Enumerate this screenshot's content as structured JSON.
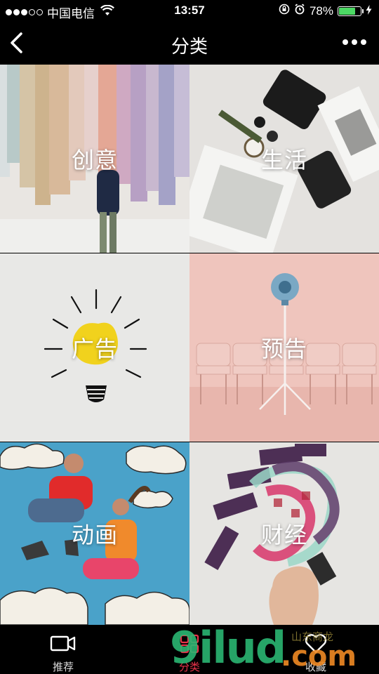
{
  "status_bar": {
    "carrier": "中国电信",
    "time": "13:57",
    "battery_percent": "78%",
    "battery_level": 0.78,
    "battery_color": "#4cd964"
  },
  "nav": {
    "title": "分类",
    "back_icon": "chevron-left-icon",
    "more_icon": "more-dots-icon"
  },
  "categories": [
    {
      "label": "创意",
      "icon": "paper-strips-photo"
    },
    {
      "label": "生活",
      "icon": "desk-flatlay-photo"
    },
    {
      "label": "广告",
      "icon": "lightbulb-photo"
    },
    {
      "label": "预告",
      "icon": "megaphone-photo"
    },
    {
      "label": "动画",
      "icon": "couple-clouds-photo"
    },
    {
      "label": "财经",
      "icon": "cards-photo"
    }
  ],
  "tabbar": {
    "tabs": [
      {
        "label": "推荐",
        "icon": "video-camera-icon"
      },
      {
        "label": "分类",
        "icon": "category-icon"
      },
      {
        "label": "收藏",
        "icon": "heart-icon"
      }
    ],
    "active_color": "#e8334a"
  },
  "watermark": {
    "brand": "9ilud",
    "domain": ".com",
    "chinese": "山东商龙"
  }
}
